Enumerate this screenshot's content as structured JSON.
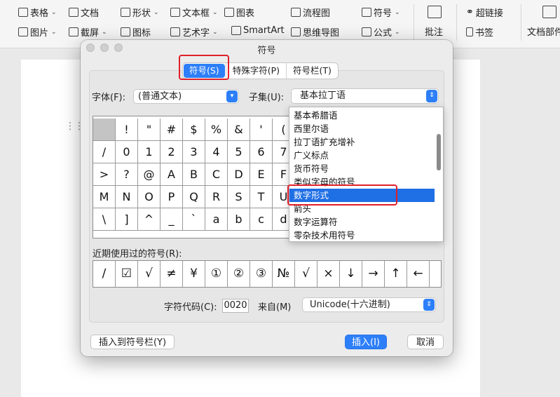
{
  "toolbar": {
    "row1": [
      {
        "label": "表格",
        "icon": "table-icon",
        "caret": true
      },
      {
        "label": "文档",
        "icon": "document-icon",
        "caret": false
      },
      {
        "label": "形状",
        "icon": "shapes-icon",
        "caret": true
      },
      {
        "label": "文本框",
        "icon": "textbox-icon",
        "caret": true
      },
      {
        "label": "图表",
        "icon": "chart-icon",
        "caret": false
      },
      {
        "label": "流程图",
        "icon": "flowchart-icon",
        "caret": false
      },
      {
        "label": "符号",
        "icon": "omega-icon",
        "caret": true
      }
    ],
    "row2": [
      {
        "label": "图片",
        "icon": "picture-icon",
        "caret": true
      },
      {
        "label": "截屏",
        "icon": "screenshot-icon",
        "caret": true
      },
      {
        "label": "图标",
        "icon": "icons-icon",
        "caret": false
      },
      {
        "label": "艺术字",
        "icon": "wordart-icon",
        "caret": true
      },
      {
        "label": "SmartArt",
        "icon": "smartart-icon",
        "caret": false
      },
      {
        "label": "思维导图",
        "icon": "mindmap-icon",
        "caret": false
      },
      {
        "label": "公式",
        "icon": "formula-icon",
        "caret": true
      }
    ],
    "comment": "批注",
    "hyperlink": "超链接",
    "bookmark": "书签",
    "doc_parts": "文档部件"
  },
  "dialog": {
    "title": "符号",
    "tabs": [
      "符号(S)",
      "特殊字符(P)",
      "符号栏(T)"
    ],
    "active_tab": 0,
    "font_label": "字体(F):",
    "font_value": "(普通文本)",
    "subset_label": "子集(U):",
    "subset_value": "基本拉丁语",
    "grid": [
      [
        "",
        "!",
        "\"",
        "#",
        "$",
        "%",
        "&",
        "'",
        "("
      ],
      [
        "/",
        "0",
        "1",
        "2",
        "3",
        "4",
        "5",
        "6",
        "7"
      ],
      [
        ">",
        "?",
        "@",
        "A",
        "B",
        "C",
        "D",
        "E",
        "F"
      ],
      [
        "M",
        "N",
        "O",
        "P",
        "Q",
        "R",
        "S",
        "T",
        "U"
      ],
      [
        "\\",
        "]",
        "^",
        "_",
        "`",
        "a",
        "b",
        "c",
        "d"
      ]
    ],
    "subset_options": [
      "基本希腊语",
      "西里尔语",
      "拉丁语扩充增补",
      "广义标点",
      "货币符号",
      "类似字母的符号",
      "数字形式",
      "箭头",
      "数字运算符",
      "零杂技术用符号"
    ],
    "highlighted_option": 6,
    "recent_label": "近期使用过的符号(R):",
    "recent_symbols": [
      "∕",
      "☑",
      "√",
      "≠",
      "¥",
      "①",
      "②",
      "③",
      "№",
      "√",
      "×",
      "↓",
      "→",
      "↑",
      "←"
    ],
    "char_code_label": "字符代码(C):",
    "char_code_value": "0020",
    "from_label": "来自(M)",
    "from_value": "Unicode(十六进制)",
    "btn_add_to_bar": "插入到符号栏(Y)",
    "btn_insert": "插入(I)",
    "btn_cancel": "取消"
  },
  "colors": {
    "accent": "#2d7ff9",
    "highlight": "#e0202a"
  }
}
